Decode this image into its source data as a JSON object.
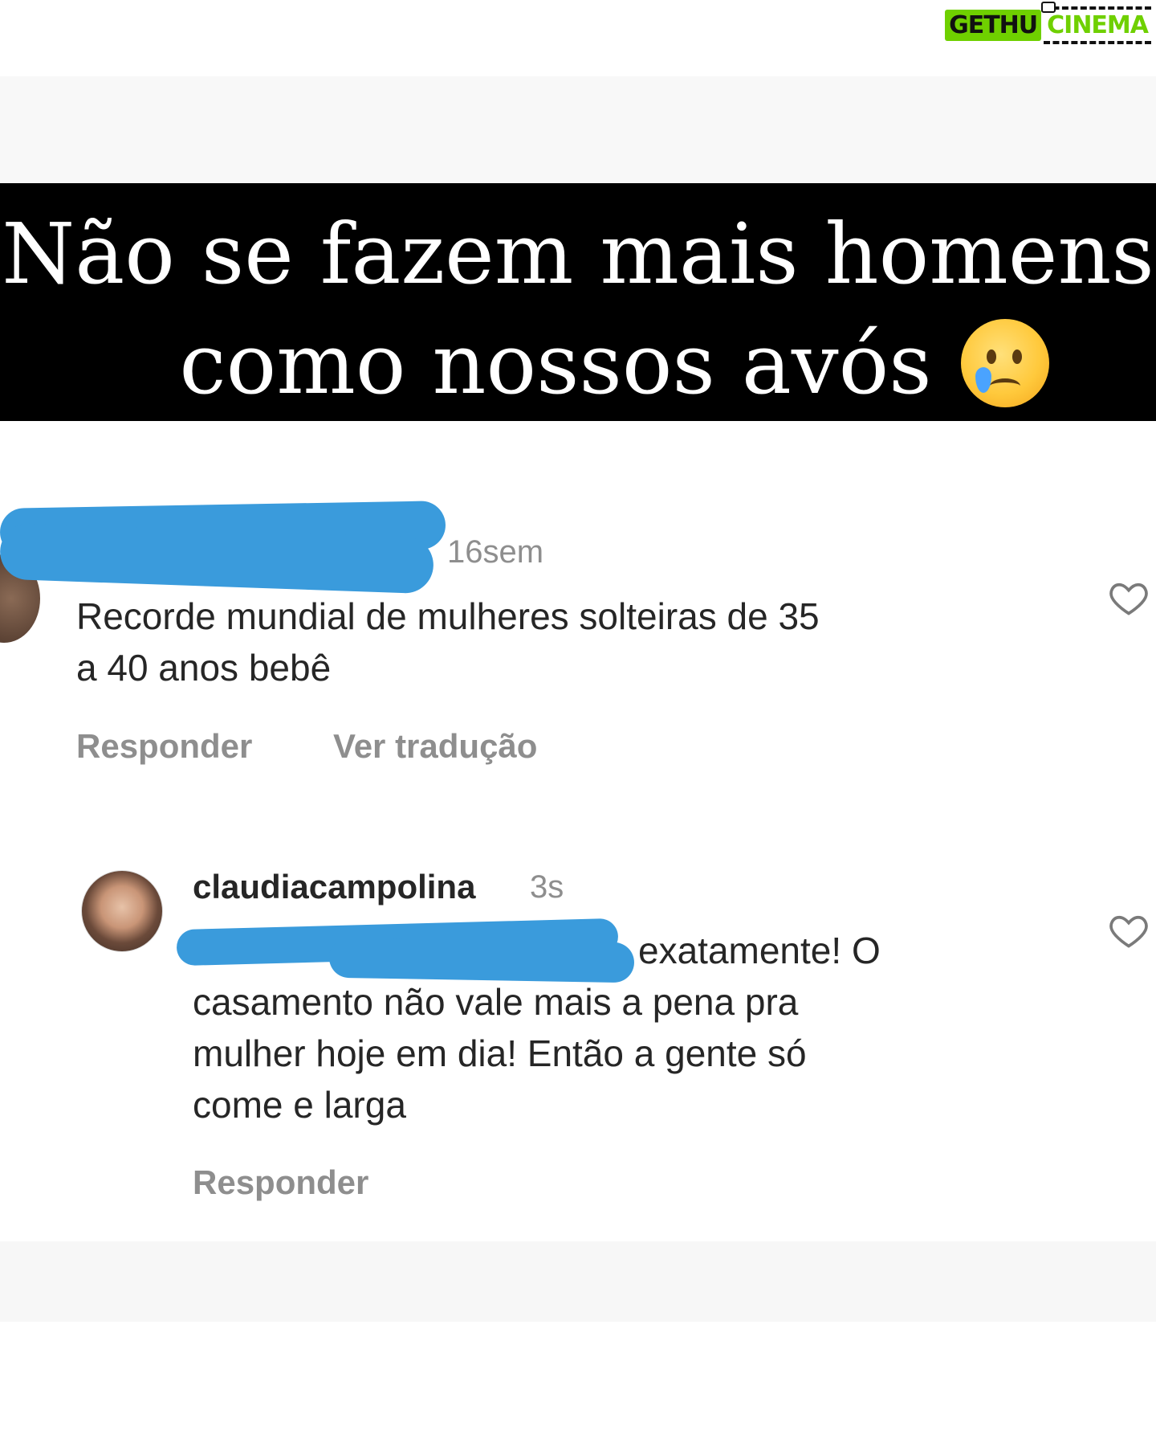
{
  "watermark": {
    "left": "GETHU",
    "right": "CINEMA"
  },
  "banner": {
    "line1": "Não se fazem mais homens",
    "line2": "como nossos avós",
    "emoji_icon": "crying-face-emoji"
  },
  "comment1": {
    "timestamp": "16sem",
    "text_line1": "Recorde mundial de mulheres solteiras de 35",
    "text_line2": "a 40 anos bebê",
    "reply_label": "Responder",
    "translate_label": "Ver tradução",
    "like_icon": "heart-icon"
  },
  "comment2": {
    "username": "claudiacampolina",
    "timestamp": "3s",
    "text_line1": "exatamente! O",
    "text_line2": "casamento não vale mais a pena pra",
    "text_line3": "mulher hoje em dia! Então a gente só",
    "text_line4": "come e larga",
    "reply_label": "Responder",
    "like_icon": "heart-icon"
  },
  "colors": {
    "redaction": "#3a9bdc",
    "banner_bg": "#000000",
    "muted_text": "#8e8e8e"
  }
}
